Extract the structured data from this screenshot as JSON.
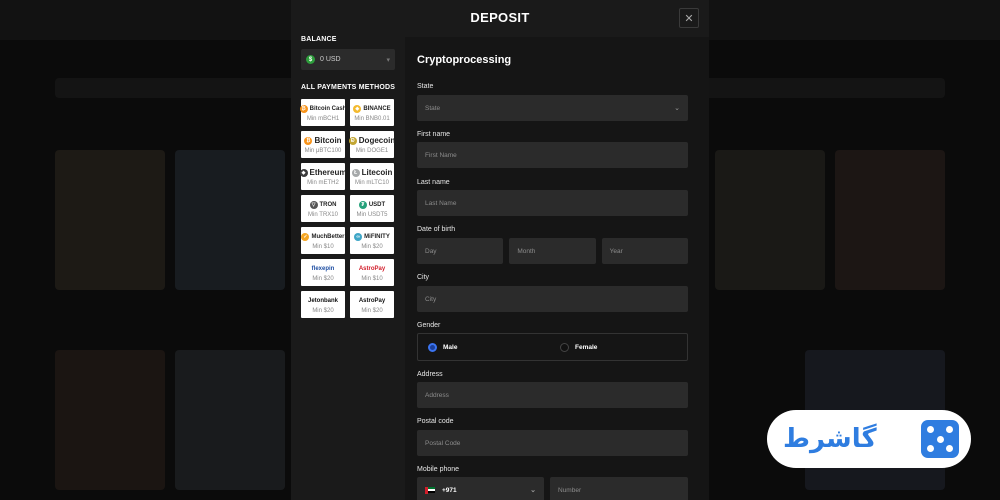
{
  "modal": {
    "title": "DEPOSIT",
    "close_glyph": "✕"
  },
  "balance": {
    "label": "BALANCE",
    "currency_glyph": "$",
    "value": "0 USD"
  },
  "methods_label": "ALL PAYMENTS METHODS",
  "methods": [
    {
      "name": "Bitcoin Cash",
      "min": "Min mBCH1",
      "icon": "bitcoin-cash-icon",
      "color": "#f7931a",
      "glyph": "₿"
    },
    {
      "name": "BINANCE",
      "min": "Min BNB0.01",
      "icon": "binance-icon",
      "color": "#f3ba2f",
      "glyph": "◆"
    },
    {
      "name": "Bitcoin",
      "min": "Min μBTC100",
      "icon": "bitcoin-icon",
      "color": "#f7931a",
      "glyph": "₿"
    },
    {
      "name": "Dogecoin",
      "min": "Min DOGE1",
      "icon": "dogecoin-icon",
      "color": "#c2a633",
      "glyph": "Ð"
    },
    {
      "name": "Ethereum",
      "min": "Min mETH2",
      "icon": "ethereum-icon",
      "color": "#3c3c3d",
      "glyph": "◆"
    },
    {
      "name": "Litecoin",
      "min": "Min mLTC10",
      "icon": "litecoin-icon",
      "color": "#a6a9aa",
      "glyph": "Ł"
    },
    {
      "name": "TRON",
      "min": "Min TRX10",
      "icon": "tron-icon",
      "color": "#555555",
      "glyph": "▽"
    },
    {
      "name": "USDT",
      "min": "Min USDT5",
      "icon": "tether-icon",
      "color": "#26a17b",
      "glyph": "₮"
    },
    {
      "name": "MuchBetter",
      "min": "Min $10",
      "icon": "muchbetter-icon",
      "color": "#f5a623",
      "glyph": "✓"
    },
    {
      "name": "MiFINITY",
      "min": "Min $20",
      "icon": "mifinity-icon",
      "color": "#3ea6c7",
      "glyph": "∞"
    },
    {
      "name": "flexepin",
      "min": "Min $20",
      "icon": "flexepin-icon",
      "color": "#1f4fa3",
      "glyph": ""
    },
    {
      "name": "AstroPay",
      "min": "Min $10",
      "icon": "astropay-flags-icon",
      "color": "#d21e2b",
      "glyph": ""
    },
    {
      "name": "Jetonbank",
      "min": "Min $20",
      "icon": "jetonbank-icon",
      "color": "#111111",
      "glyph": ""
    },
    {
      "name": "AstroPay",
      "min": "Min $20",
      "icon": "astropay-icon",
      "color": "#111111",
      "glyph": ""
    }
  ],
  "form": {
    "title": "Cryptoprocessing",
    "state": {
      "label": "State",
      "placeholder": "State"
    },
    "first_name": {
      "label": "First name",
      "placeholder": "First Name"
    },
    "last_name": {
      "label": "Last name",
      "placeholder": "Last Name"
    },
    "dob": {
      "label": "Date of birth",
      "day": "Day",
      "month": "Month",
      "year": "Year"
    },
    "city": {
      "label": "City",
      "placeholder": "City"
    },
    "gender": {
      "label": "Gender",
      "male": "Male",
      "female": "Female",
      "selected": "Male"
    },
    "address": {
      "label": "Address",
      "placeholder": "Address"
    },
    "postal": {
      "label": "Postal code",
      "placeholder": "Postal Code"
    },
    "phone": {
      "label": "Mobile phone",
      "code": "+971",
      "placeholder": "Number"
    }
  },
  "watermark": {
    "text": "گاشرط"
  },
  "colors": {
    "accent": "#3b74f0",
    "panel": "#151515",
    "input": "#2b2b2b",
    "watermark": "#2f7de0"
  }
}
